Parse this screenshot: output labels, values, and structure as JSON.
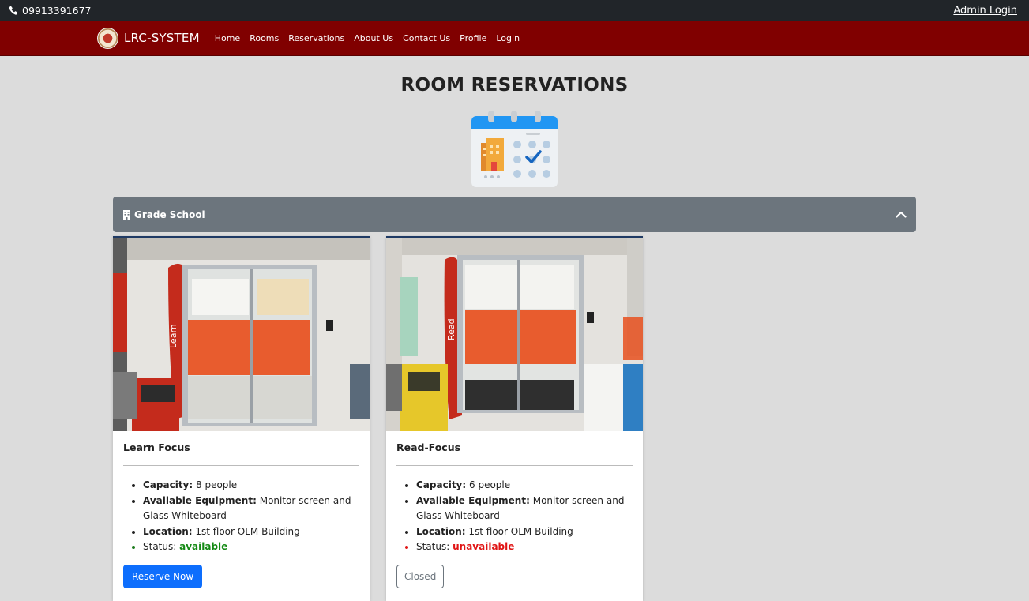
{
  "topbar": {
    "phone": "09913391677",
    "admin_login": "Admin Login",
    "phone_icon": "phone-icon"
  },
  "navbar": {
    "brand": "LRC-SYSTEM",
    "links": [
      "Home",
      "Rooms",
      "Reservations",
      "About Us",
      "Contact Us",
      "Profile",
      "Login"
    ]
  },
  "page": {
    "title": "ROOM RESERVATIONS",
    "hero_icon": "calendar-building-icon"
  },
  "section": {
    "title": "Grade School",
    "icon": "building-icon",
    "toggle_icon": "chevron-up-icon"
  },
  "rooms": [
    {
      "name": "Learn Focus",
      "capacity_label": "Capacity:",
      "capacity": "8 people",
      "equipment_label": "Available Equipment:",
      "equipment": "Monitor screen and Glass Whiteboard",
      "location_label": "Location:",
      "location": "1st floor OLM Building",
      "status_label": "Status:",
      "status": "available",
      "action": "Reserve Now",
      "wall_text": "Learn"
    },
    {
      "name": "Read-Focus",
      "capacity_label": "Capacity:",
      "capacity": "6 people",
      "equipment_label": "Available Equipment:",
      "equipment": "Monitor screen and Glass Whiteboard",
      "location_label": "Location:",
      "location": "1st floor OLM Building",
      "status_label": "Status:",
      "status": "unavailable",
      "action": "Closed",
      "wall_text": "Read"
    }
  ],
  "colors": {
    "navbar": "#800000",
    "topbar": "#212529",
    "accordion": "#6c757d",
    "primary": "#0d6efd",
    "available": "#148a14",
    "unavailable": "#e01414"
  }
}
